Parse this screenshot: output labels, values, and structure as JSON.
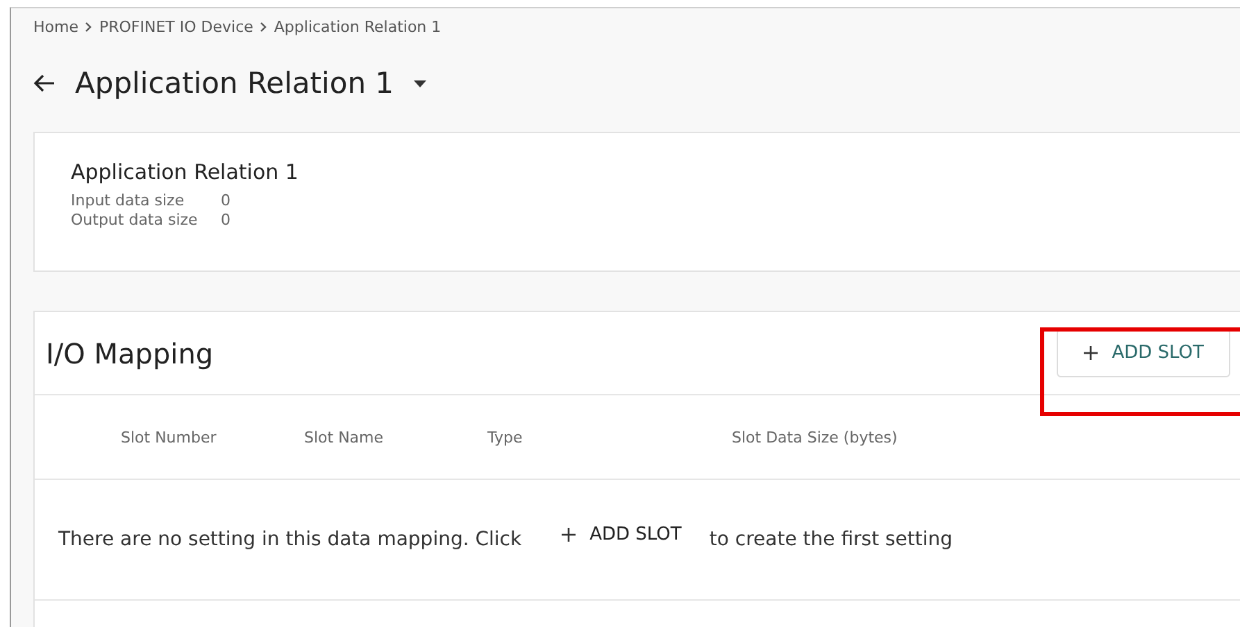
{
  "breadcrumb": [
    "Home",
    "PROFINET IO Device",
    "Application Relation 1"
  ],
  "page_title": "Application Relation 1",
  "summary": {
    "title": "Application Relation 1",
    "fields": [
      {
        "label": "Input data size",
        "value": "0"
      },
      {
        "label": "Output data size",
        "value": "0"
      }
    ]
  },
  "io_mapping": {
    "title": "I/O Mapping",
    "add_button": "ADD SLOT",
    "highlighted": true,
    "columns": [
      "Slot Number",
      "Slot Name",
      "Type",
      "Slot Data Size (bytes)"
    ],
    "empty_message": {
      "before": "There are no setting in this data mapping. Click",
      "button": "ADD SLOT",
      "after": "to create the first setting"
    }
  }
}
